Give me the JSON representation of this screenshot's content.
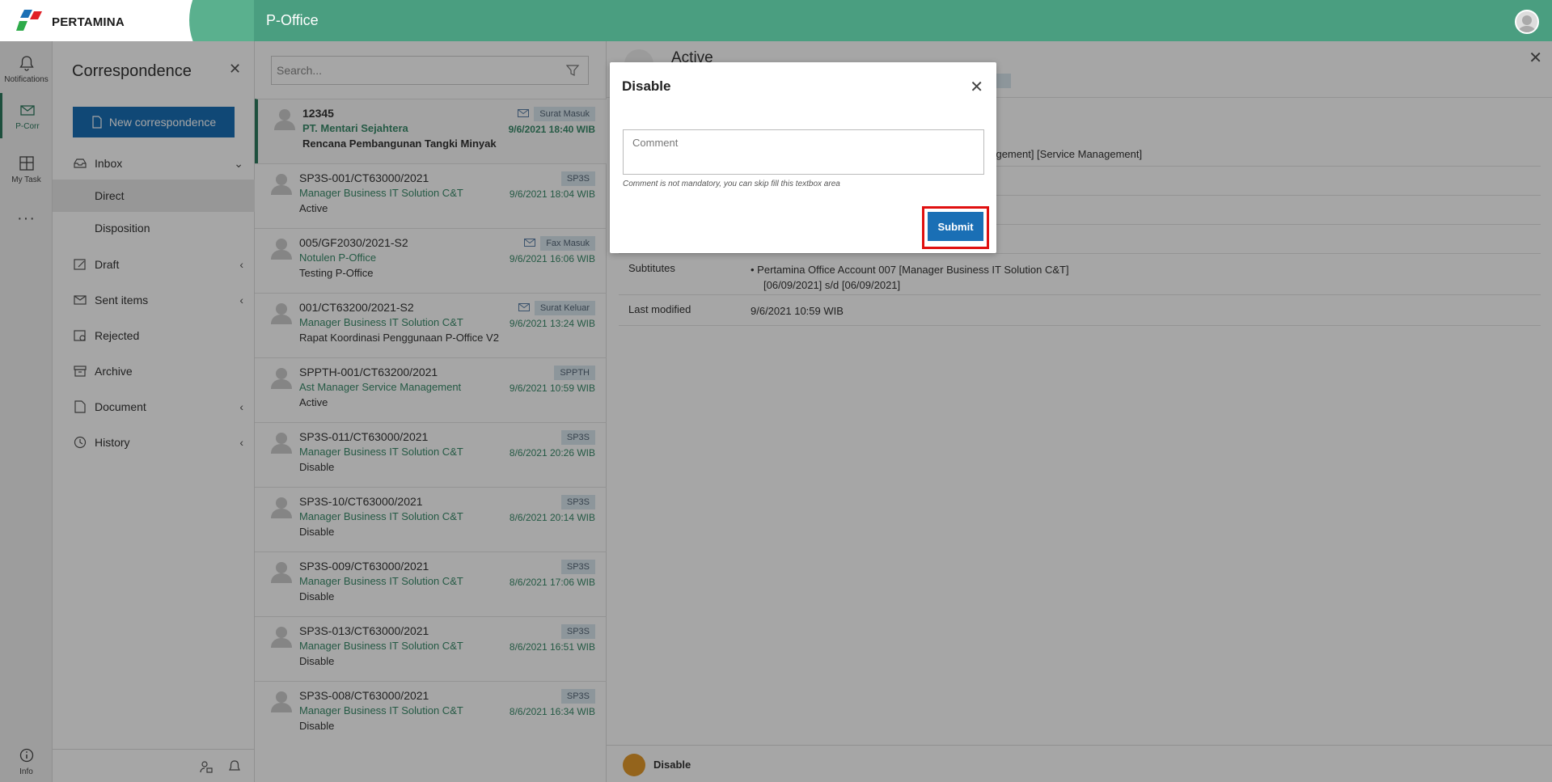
{
  "header": {
    "logo_text": "PERTAMINA",
    "app_title": "P-Office"
  },
  "rail": {
    "items": [
      {
        "label": "Notifications",
        "icon": "bell-icon"
      },
      {
        "label": "P-Corr",
        "icon": "mail-icon"
      },
      {
        "label": "My Task",
        "icon": "grid-icon"
      }
    ],
    "more": "···",
    "info_label": "Info"
  },
  "sidenav": {
    "title": "Correspondence",
    "new_button": "New correspondence",
    "items": [
      {
        "label": "Inbox",
        "icon": "inbox-icon",
        "chevron": "down"
      },
      {
        "label": "Direct",
        "sub": true
      },
      {
        "label": "Disposition",
        "sub": true
      },
      {
        "label": "Draft",
        "icon": "draft-icon",
        "chevron": "left"
      },
      {
        "label": "Sent items",
        "icon": "sent-icon",
        "chevron": "left"
      },
      {
        "label": "Rejected",
        "icon": "rejected-icon"
      },
      {
        "label": "Archive",
        "icon": "archive-icon"
      },
      {
        "label": "Document",
        "icon": "document-icon",
        "chevron": "left"
      },
      {
        "label": "History",
        "icon": "history-icon",
        "chevron": "left"
      }
    ]
  },
  "list": {
    "search_placeholder": "Search...",
    "messages": [
      {
        "ref": "12345",
        "sender": "PT. Mentari Sejahtera",
        "subject": "Rencana Pembangunan Tangki Minyak",
        "badge": "Surat Masuk",
        "date": "9/6/2021 18:40 WIB",
        "mail": true
      },
      {
        "ref": "SP3S-001/CT63000/2021",
        "sender": "Manager Business IT Solution C&T",
        "subject": "Active",
        "badge": "SP3S",
        "date": "9/6/2021 18:04 WIB",
        "mail": false
      },
      {
        "ref": "005/GF2030/2021-S2",
        "sender": "Notulen P-Office",
        "subject": "Testing P-Office",
        "badge": "Fax Masuk",
        "date": "9/6/2021 16:06 WIB",
        "mail": true
      },
      {
        "ref": "001/CT63200/2021-S2",
        "sender": "Manager Business IT Solution C&T",
        "subject": "Rapat Koordinasi Penggunaan P-Office V2",
        "badge": "Surat Keluar",
        "date": "9/6/2021 13:24 WIB",
        "mail": true
      },
      {
        "ref": "SPPTH-001/CT63200/2021",
        "sender": "Ast Manager Service Management",
        "subject": "Active",
        "badge": "SPPTH",
        "date": "9/6/2021 10:59 WIB",
        "mail": false
      },
      {
        "ref": "SP3S-011/CT63000/2021",
        "sender": "Manager Business IT Solution C&T",
        "subject": "Disable",
        "badge": "SP3S",
        "date": "8/6/2021 20:26 WIB",
        "mail": false
      },
      {
        "ref": "SP3S-10/CT63000/2021",
        "sender": "Manager Business IT Solution C&T",
        "subject": "Disable",
        "badge": "SP3S",
        "date": "8/6/2021 20:14 WIB",
        "mail": false
      },
      {
        "ref": "SP3S-009/CT63000/2021",
        "sender": "Manager Business IT Solution C&T",
        "subject": "Disable",
        "badge": "SP3S",
        "date": "8/6/2021 17:06 WIB",
        "mail": false
      },
      {
        "ref": "SP3S-013/CT63000/2021",
        "sender": "Manager Business IT Solution C&T",
        "subject": "Disable",
        "badge": "SP3S",
        "date": "8/6/2021 16:51 WIB",
        "mail": false
      },
      {
        "ref": "SP3S-008/CT63000/2021",
        "sender": "Manager Business IT Solution C&T",
        "subject": "Disable",
        "badge": "SP3S",
        "date": "8/6/2021 16:34 WIB",
        "mail": false
      }
    ]
  },
  "detail": {
    "status": "Active",
    "partial_text": "nagement] [Service Management]",
    "substitutes_label": "Subtitutes",
    "substitutes_value_1": "Pertamina Office Account 007 [Manager Business IT Solution C&T]",
    "substitutes_value_2": "[06/09/2021] s/d [06/09/2021]",
    "last_modified_label": "Last modified",
    "last_modified_value": "9/6/2021 10:59 WIB",
    "footer_action": "Disable"
  },
  "modal": {
    "title": "Disable",
    "comment_placeholder": "Comment",
    "comment_value": "",
    "hint": "Comment is not mandatory, you can skip fill this textbox area",
    "submit_label": "Submit"
  },
  "colors": {
    "brand_green": "#4a9e80",
    "primary_blue": "#1a6fb5",
    "highlight_red": "#e01010"
  }
}
